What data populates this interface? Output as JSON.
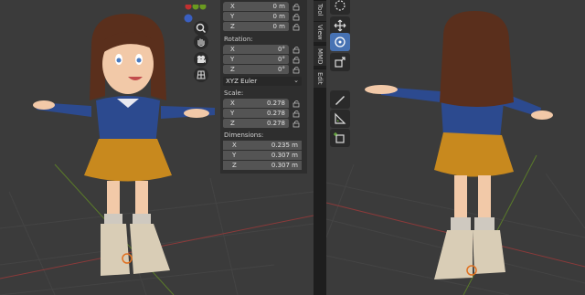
{
  "app": "Blender",
  "left_viewport": {
    "nav_buttons": [
      {
        "name": "zoom",
        "icon": "magnifier-icon"
      },
      {
        "name": "pan",
        "icon": "hand-icon"
      },
      {
        "name": "camera",
        "icon": "camera-icon"
      },
      {
        "name": "perspective",
        "icon": "grid-icon"
      }
    ]
  },
  "n_panel": {
    "location": {
      "rows": [
        {
          "axis": "X",
          "value": "0 m"
        },
        {
          "axis": "Y",
          "value": "0 m"
        },
        {
          "axis": "Z",
          "value": "0 m"
        }
      ]
    },
    "rotation": {
      "label": "Rotation:",
      "rows": [
        {
          "axis": "X",
          "value": "0°"
        },
        {
          "axis": "Y",
          "value": "0°"
        },
        {
          "axis": "Z",
          "value": "0°"
        }
      ],
      "mode": "XYZ Euler"
    },
    "scale": {
      "label": "Scale:",
      "rows": [
        {
          "axis": "X",
          "value": "0.278"
        },
        {
          "axis": "Y",
          "value": "0.278"
        },
        {
          "axis": "Z",
          "value": "0.278"
        }
      ]
    },
    "dimensions": {
      "label": "Dimensions:",
      "rows": [
        {
          "axis": "X",
          "value": "0.235 m"
        },
        {
          "axis": "Y",
          "value": "0.307 m"
        },
        {
          "axis": "Z",
          "value": "0.307 m"
        }
      ]
    }
  },
  "sidebar_tabs": [
    "Tool",
    "View",
    "MMD",
    "Edit"
  ],
  "toolbar": {
    "tools": [
      {
        "name": "cursor",
        "icon": "cursor-icon"
      },
      {
        "name": "move",
        "icon": "move-icon"
      },
      {
        "name": "rotate",
        "icon": "rotate-icon",
        "active": true
      },
      {
        "name": "scale",
        "icon": "scale-icon"
      },
      {
        "name": "annotate",
        "icon": "annotate-icon"
      },
      {
        "name": "measure",
        "icon": "measure-icon"
      },
      {
        "name": "add-cube",
        "icon": "add-cube-icon"
      }
    ]
  },
  "colors": {
    "viewport_bg": "#3b3b3b",
    "panel_bg": "#2e2e2e",
    "field_bg": "#545454",
    "active_tool": "#4772b3",
    "shirt": "#2c4a8f",
    "skirt": "#c8891e",
    "hair": "#5a2f1c"
  }
}
